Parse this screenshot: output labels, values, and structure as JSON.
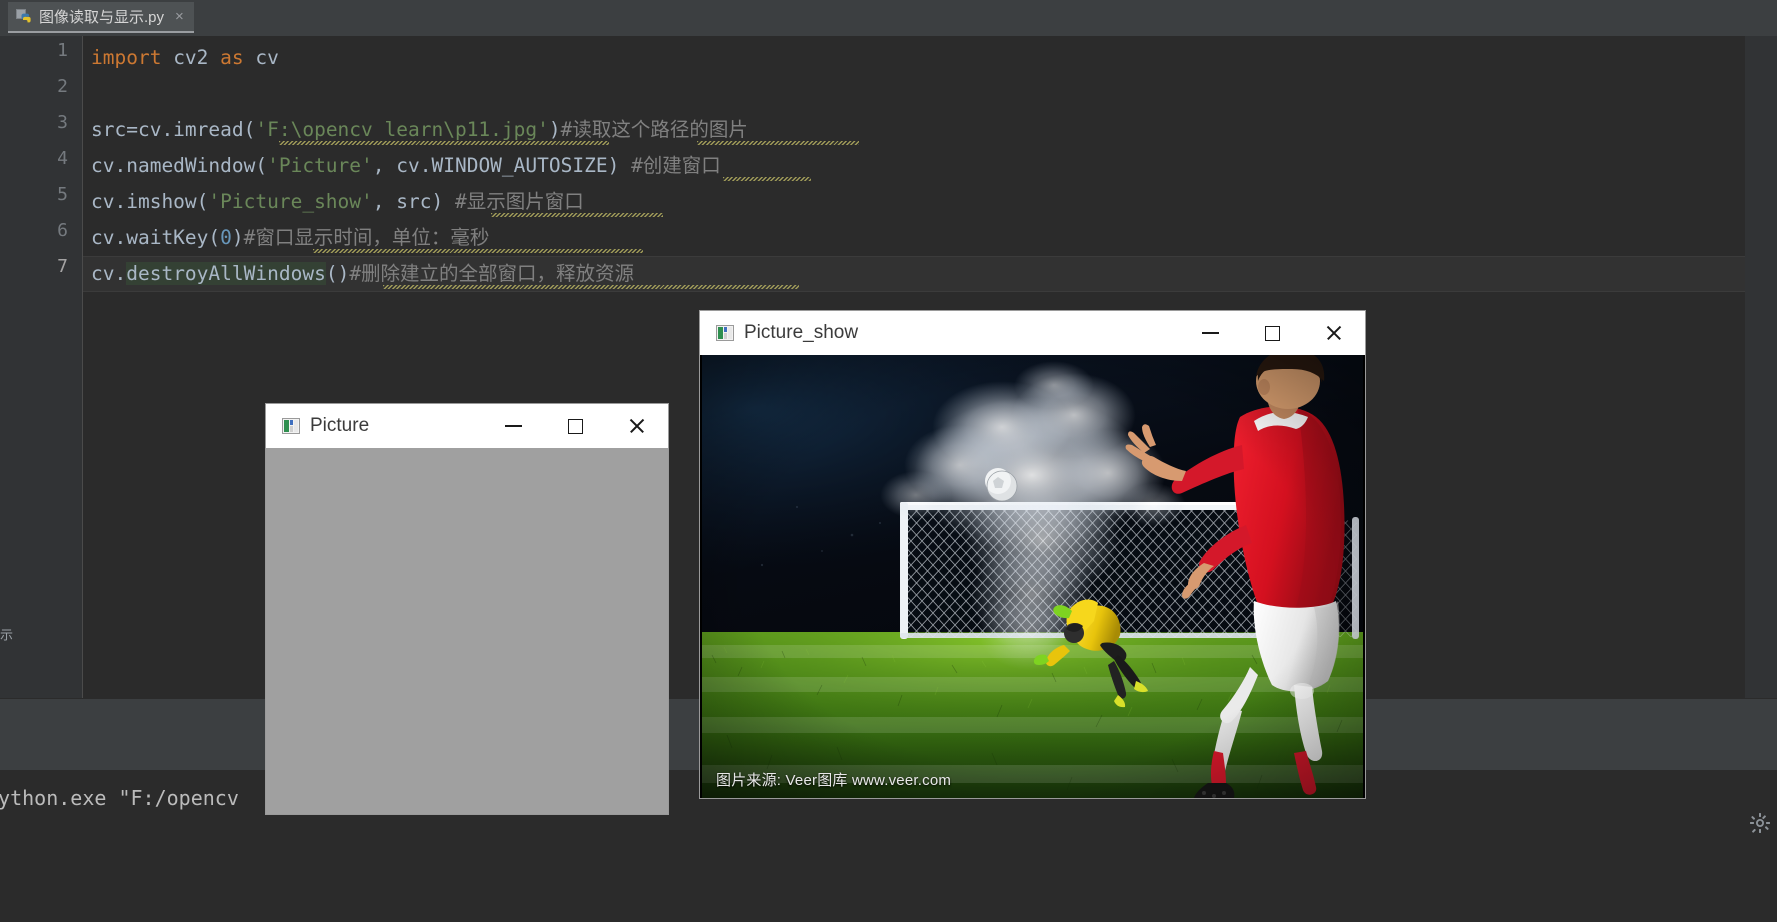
{
  "ide": {
    "tab": {
      "label": "图像读取与显示.py",
      "icon": "python-file-icon",
      "close_label": "×"
    },
    "gutter_numbers": [
      "1",
      "2",
      "3",
      "4",
      "5",
      "6",
      "7"
    ],
    "current_line": "7",
    "code": {
      "line1": {
        "kw1": "import",
        "mod": " cv2 ",
        "kw2": "as",
        "alias": " cv"
      },
      "line3": {
        "head": "src=cv.imread(",
        "string": "'F:\\opencv learn\\p11.jpg'",
        "tail": ")",
        "comment": "#读取这个路径的图片"
      },
      "line4": {
        "head": "cv.namedWindow(",
        "string": "'Picture'",
        "mid": ", cv.WINDOW_AUTOSIZE)",
        "comment": " #创建窗口"
      },
      "line5": {
        "head": "cv.imshow(",
        "string": "'Picture_show'",
        "mid": ", src)",
        "comment": " #显示图片窗口"
      },
      "line6": {
        "head": "cv.waitKey(",
        "num": "0",
        "tail": ")",
        "comment": "#窗口显示时间，单位：毫秒"
      },
      "line7": {
        "head": "cv.",
        "highlighted": "destroyAllWindows",
        "tail": "()",
        "comment": "#删除建立的全部窗口，释放资源"
      }
    },
    "console": {
      "text": "python.exe \"F:/opencv",
      "trailing_quote": "\""
    },
    "colors": {
      "editor_bg": "#2b2b2b",
      "chrome_bg": "#3c3f41",
      "keyword": "#cc7832",
      "string": "#6a8759",
      "number": "#6897bb",
      "comment": "#808080",
      "identifier": "#a9b7c6",
      "highlight": "#344134"
    }
  },
  "windows": [
    {
      "id": "picture",
      "title": "Picture",
      "icon": "image-window-icon",
      "buttons": {
        "minimize": "minimize-button",
        "maximize": "maximize-button",
        "close": "close-button"
      },
      "body": "empty-gray-canvas"
    },
    {
      "id": "picture_show",
      "title": "Picture_show",
      "icon": "image-window-icon",
      "buttons": {
        "minimize": "minimize-button",
        "maximize": "maximize-button",
        "close": "close-button"
      },
      "body": "photo-soccer-penalty",
      "watermark": "图片来源: Veer图库 www.veer.com"
    }
  ],
  "photo": {
    "description": "soccer-penalty-kick",
    "watermark": "图片来源: Veer图库 www.veer.com",
    "colors": {
      "jersey_red": "#d4182a",
      "keeper_yellow": "#f0d217",
      "grass": "#3e7a14",
      "sky_dark": "#070c17",
      "smoke": "#e9eef5"
    }
  }
}
